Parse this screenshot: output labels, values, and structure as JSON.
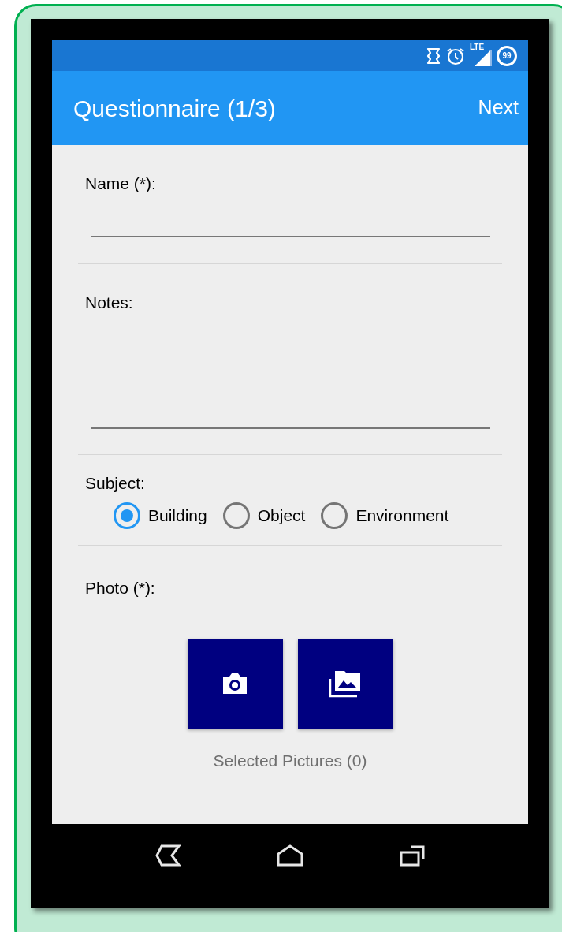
{
  "status_bar": {
    "network": "LTE",
    "battery": "99"
  },
  "app_bar": {
    "title": "Questionnaire (1/3)",
    "action": "Next"
  },
  "fields": [
    {
      "kind": "text",
      "label": "Name (*):"
    },
    {
      "kind": "textarea",
      "label": "Notes:"
    }
  ],
  "subject": {
    "label": "Subject:",
    "options": [
      {
        "label": "Building",
        "selected": true
      },
      {
        "label": "Object",
        "selected": false
      },
      {
        "label": "Environment",
        "selected": false
      }
    ]
  },
  "photo": {
    "label": "Photo (*):",
    "selected_count": "Selected Pictures (0)"
  }
}
